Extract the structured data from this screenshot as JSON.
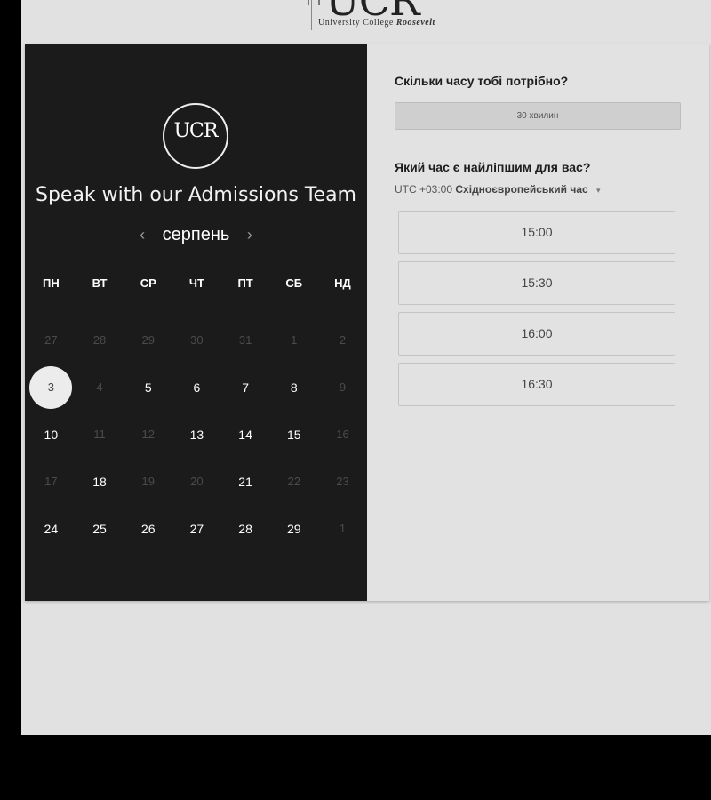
{
  "header": {
    "logo_text": "UCR",
    "logo_subtitle_pre": "University College ",
    "logo_subtitle_emph": "Roosevelt"
  },
  "left": {
    "circle_logo_text": "UCR",
    "heading": "Speak with our Admissions Team",
    "calendar": {
      "month": "серпень",
      "prev_icon": "‹",
      "next_icon": "›",
      "weekdays": [
        "ПН",
        "ВТ",
        "СР",
        "ЧТ",
        "ПТ",
        "СБ",
        "НД"
      ],
      "days": [
        {
          "n": "27",
          "state": "dim"
        },
        {
          "n": "28",
          "state": "dim"
        },
        {
          "n": "29",
          "state": "dim"
        },
        {
          "n": "30",
          "state": "dim"
        },
        {
          "n": "31",
          "state": "dim"
        },
        {
          "n": "1",
          "state": "dim"
        },
        {
          "n": "2",
          "state": "dim"
        },
        {
          "n": "3",
          "state": "selected"
        },
        {
          "n": "4",
          "state": "dim"
        },
        {
          "n": "5",
          "state": "available"
        },
        {
          "n": "6",
          "state": "available"
        },
        {
          "n": "7",
          "state": "available"
        },
        {
          "n": "8",
          "state": "available"
        },
        {
          "n": "9",
          "state": "dim"
        },
        {
          "n": "10",
          "state": "available"
        },
        {
          "n": "11",
          "state": "dim"
        },
        {
          "n": "12",
          "state": "dim"
        },
        {
          "n": "13",
          "state": "available"
        },
        {
          "n": "14",
          "state": "available"
        },
        {
          "n": "15",
          "state": "available"
        },
        {
          "n": "16",
          "state": "dim"
        },
        {
          "n": "17",
          "state": "dim"
        },
        {
          "n": "18",
          "state": "available"
        },
        {
          "n": "19",
          "state": "dim"
        },
        {
          "n": "20",
          "state": "dim"
        },
        {
          "n": "21",
          "state": "available"
        },
        {
          "n": "22",
          "state": "dim"
        },
        {
          "n": "23",
          "state": "dim"
        },
        {
          "n": "24",
          "state": "available"
        },
        {
          "n": "25",
          "state": "available"
        },
        {
          "n": "26",
          "state": "available"
        },
        {
          "n": "27",
          "state": "available"
        },
        {
          "n": "28",
          "state": "available"
        },
        {
          "n": "29",
          "state": "available"
        },
        {
          "n": "1",
          "state": "dim"
        }
      ]
    }
  },
  "right": {
    "duration_question": "Скільки часу тобі потрібно?",
    "duration_value": "30 хвилин",
    "time_question": "Який час є найліпшим для вас?",
    "tz_offset": "UTC +03:00",
    "tz_name": "Східноєвропейський час",
    "tz_caret": "▾",
    "slots": [
      "15:00",
      "15:30",
      "16:00",
      "16:30"
    ]
  }
}
